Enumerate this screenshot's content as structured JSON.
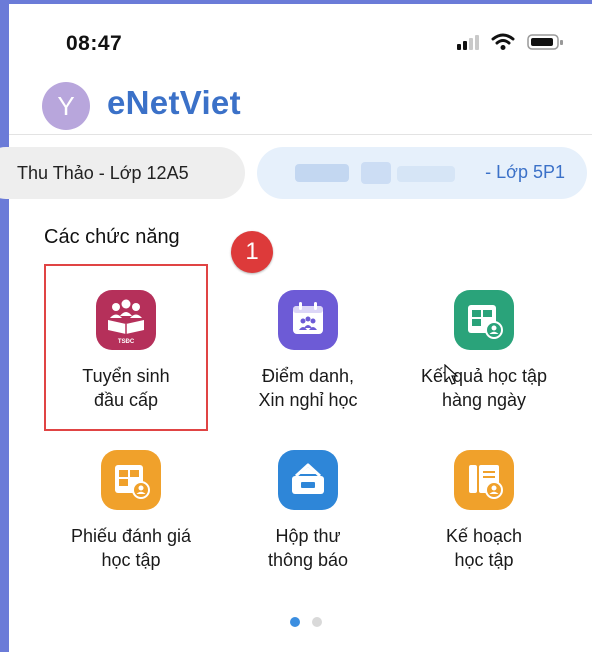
{
  "status": {
    "time": "08:47"
  },
  "header": {
    "avatar_letter": "Y",
    "app_name": "eNetViet"
  },
  "students": [
    {
      "label": "Thu Thảo - Lớp 12A5",
      "selected": true
    },
    {
      "label": "- Lớp 5P1",
      "selected": false
    }
  ],
  "section": {
    "title": "Các chức năng",
    "step_badge": "1"
  },
  "functions": [
    {
      "line1": "Tuyển sinh",
      "line2": "đầu cấp",
      "icon": "tsdc-admission-icon",
      "icon_text": "TSĐC",
      "color": "#b5305a"
    },
    {
      "line1": "Điểm danh,",
      "line2": "Xin nghỉ học",
      "icon": "calendar-attendance-icon",
      "color": "#6d5bd6"
    },
    {
      "line1": "Kết quả học tập",
      "line2": "hàng ngày",
      "icon": "daily-results-icon",
      "color": "#2aa37a"
    },
    {
      "line1": "Phiếu đánh giá",
      "line2": "học tập",
      "icon": "assessment-sheet-icon",
      "color": "#f0a12b"
    },
    {
      "line1": "Hộp thư",
      "line2": "thông báo",
      "icon": "mailbox-icon",
      "color": "#2e86d8"
    },
    {
      "line1": "Kế hoạch",
      "line2": "học tập",
      "icon": "study-plan-book-icon",
      "color": "#f0a12b"
    }
  ],
  "pager": {
    "pages": 2,
    "current": 1,
    "active_color": "#3b8ee0",
    "inactive_color": "#d9d9d9"
  }
}
